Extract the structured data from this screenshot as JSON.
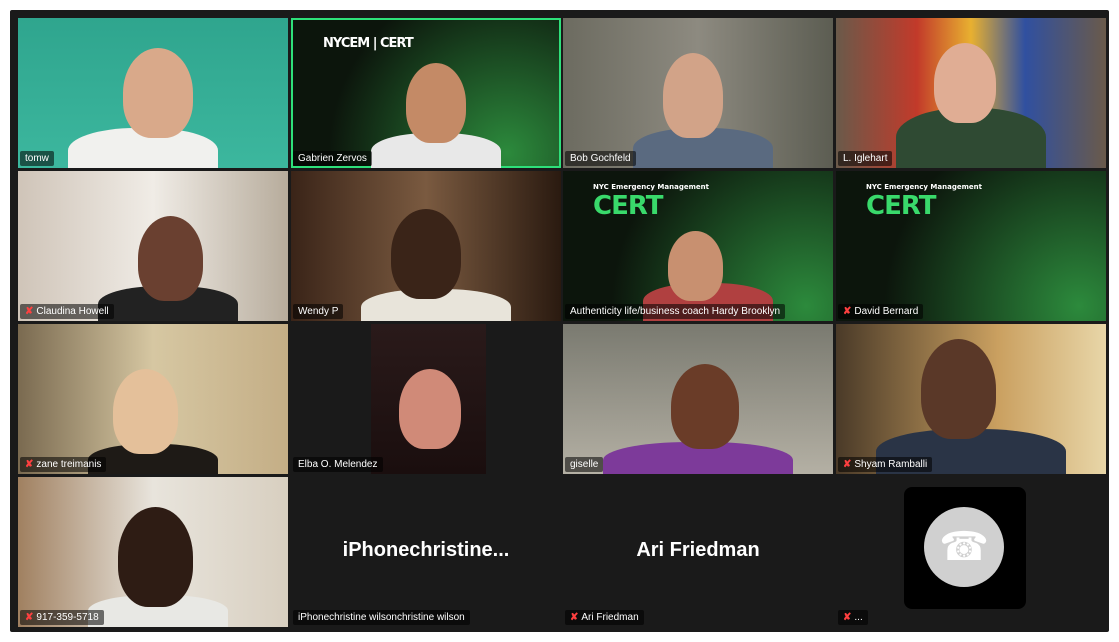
{
  "participants": [
    {
      "name": "tomw",
      "muted": false
    },
    {
      "name": "Gabrien Zervos",
      "muted": false
    },
    {
      "name": "Bob Gochfeld",
      "muted": false
    },
    {
      "name": "L. Iglehart",
      "muted": false
    },
    {
      "name": "Claudina Howell",
      "muted": true
    },
    {
      "name": "Wendy P",
      "muted": false
    },
    {
      "name": "Authenticity life/business coach Hardy Brooklyn",
      "muted": false
    },
    {
      "name": "David Bernard",
      "muted": true
    },
    {
      "name": "zane treimanis",
      "muted": true
    },
    {
      "name": "Elba O. Melendez",
      "muted": false
    },
    {
      "name": "giselle",
      "muted": false
    },
    {
      "name": "Shyam Ramballi",
      "muted": true
    },
    {
      "name": "917-359-5718",
      "muted": true
    },
    {
      "name": "iPhonechristine wilsonchristine wilson",
      "muted": false,
      "display_name": "iPhonechristine..."
    },
    {
      "name": "Ari Friedman",
      "muted": true,
      "display_name": "Ari Friedman"
    },
    {
      "name": "...",
      "muted": true
    }
  ],
  "logos": {
    "nycem": "NYCEM | CERT",
    "nyc": "NYC",
    "nyc_sub": "Emergency Management",
    "cert": "CERT"
  },
  "colors": {
    "speaking": "#2ee07a",
    "cert_green": "#39d96b",
    "muted": "#ff4040"
  }
}
